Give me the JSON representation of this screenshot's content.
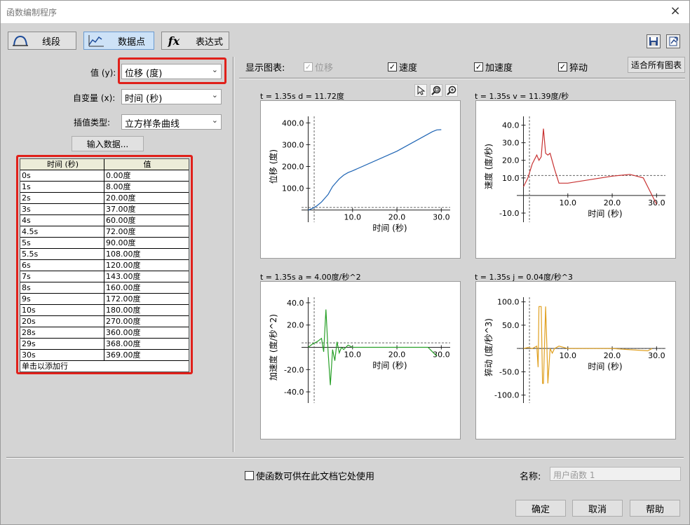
{
  "window": {
    "title": "函数编制程序",
    "close": "×"
  },
  "toolbar": {
    "tabs": [
      {
        "label": "线段",
        "icon": "line-segment-icon"
      },
      {
        "label": "数据点",
        "icon": "data-points-icon"
      },
      {
        "label": "表达式",
        "icon": "expression-icon"
      }
    ],
    "expression_glyph": "fx"
  },
  "left": {
    "value_label": "值 (y):",
    "value_selected": "位移 (度)",
    "indep_label": "自变量 (x):",
    "indep_selected": "时间 (秒)",
    "interp_label": "插值类型:",
    "interp_selected": "立方样条曲线",
    "input_button": "输入数据...",
    "table": {
      "headers": [
        "时间 (秒)",
        "值"
      ],
      "rows": [
        [
          "0s",
          "0.00度"
        ],
        [
          "1s",
          "8.00度"
        ],
        [
          "2s",
          "20.00度"
        ],
        [
          "3s",
          "37.00度"
        ],
        [
          "4s",
          "60.00度"
        ],
        [
          "4.5s",
          "72.00度"
        ],
        [
          "5s",
          "90.00度"
        ],
        [
          "5.5s",
          "108.00度"
        ],
        [
          "6s",
          "120.00度"
        ],
        [
          "7s",
          "143.00度"
        ],
        [
          "8s",
          "160.00度"
        ],
        [
          "9s",
          "172.00度"
        ],
        [
          "10s",
          "180.00度"
        ],
        [
          "20s",
          "270.00度"
        ],
        [
          "28s",
          "360.00度"
        ],
        [
          "29s",
          "368.00度"
        ],
        [
          "30s",
          "369.00度"
        ]
      ],
      "add_row": "单击以添加行"
    }
  },
  "right": {
    "show_label": "显示图表:",
    "checks": [
      {
        "label": "位移",
        "checked": true,
        "disabled": true
      },
      {
        "label": "速度",
        "checked": true,
        "disabled": false
      },
      {
        "label": "加速度",
        "checked": true,
        "disabled": false
      },
      {
        "label": "猝动",
        "checked": true,
        "disabled": false
      }
    ],
    "fit_button": "适合所有图表",
    "readouts": [
      "t = 1.35s  d = 11.72度",
      "t = 1.35s  v = 11.39度/秒",
      "t = 1.35s  a = 4.00度/秒^2",
      "t = 1.35s  j = 0.04度/秒^3"
    ]
  },
  "chart_data": [
    {
      "type": "line",
      "ylabel": "位移 (度)",
      "xlabel": "时间 (秒)",
      "xticks": [
        "10.0",
        "20.0",
        "30.0"
      ],
      "yticks": [
        "100.0",
        "200.0",
        "300.0",
        "400.0"
      ],
      "xlim": [
        -1.5,
        32
      ],
      "ylim": [
        -30,
        430
      ],
      "color": "#1e64b4",
      "cursor_x": 1.35,
      "cursor_y": 11.72,
      "x": [
        0,
        1,
        2,
        3,
        4,
        4.5,
        5,
        5.5,
        6,
        7,
        8,
        9,
        10,
        20,
        28,
        29,
        30
      ],
      "y": [
        0,
        8,
        20,
        37,
        60,
        72,
        90,
        108,
        120,
        143,
        160,
        172,
        180,
        270,
        360,
        368,
        369
      ]
    },
    {
      "type": "line",
      "ylabel": "速度 (度/秒)",
      "xlabel": "时间 (秒)",
      "xticks": [
        "10.0",
        "20.0",
        "30.0"
      ],
      "yticks": [
        "-10.0",
        "10.0",
        "20.0",
        "30.0",
        "40.0"
      ],
      "xlim": [
        -1.5,
        32
      ],
      "ylim": [
        -12,
        45
      ],
      "color": "#c83232",
      "cursor_x": 1.35,
      "cursor_y": 11.39,
      "x": [
        0,
        1,
        2,
        3,
        3.5,
        4,
        4.5,
        5,
        5.5,
        6,
        7,
        8,
        10,
        15,
        20,
        24,
        27,
        28,
        29,
        30
      ],
      "y": [
        5,
        10,
        18,
        23,
        20,
        22,
        38,
        24,
        23,
        24,
        15,
        7,
        7,
        9,
        11,
        12,
        10,
        5,
        0,
        -5
      ]
    },
    {
      "type": "line",
      "ylabel": "加速度 (度/秒^2)",
      "xlabel": "时间 (秒)",
      "xticks": [
        "10.0",
        "20.0",
        "30.0"
      ],
      "yticks": [
        "-40.0",
        "-20.0",
        "20.0",
        "40.0"
      ],
      "xlim": [
        -1.5,
        32
      ],
      "ylim": [
        -45,
        45
      ],
      "color": "#28a028",
      "cursor_x": 1.35,
      "cursor_y": 4.0,
      "x": [
        0,
        1,
        2,
        3,
        3.5,
        4,
        4.5,
        5,
        5.5,
        6,
        6.5,
        7,
        7.5,
        8,
        9,
        10,
        15,
        20,
        25,
        27,
        28,
        29
      ],
      "y": [
        0,
        3,
        5,
        8,
        -4,
        34,
        -5,
        -34,
        -2,
        -12,
        5,
        -5,
        0,
        -2,
        2,
        0,
        0,
        0,
        0,
        0,
        -4,
        -8
      ]
    },
    {
      "type": "line",
      "ylabel": "猝动 (度/秒^3)",
      "xlabel": "时间 (秒)",
      "xticks": [
        "10.0",
        "20.0",
        "30.0"
      ],
      "yticks": [
        "-100.0",
        "-50.0",
        "50.0",
        "100.0"
      ],
      "xlim": [
        -1.5,
        32
      ],
      "ylim": [
        -105,
        110
      ],
      "color": "#e0a020",
      "cursor_x": 1.35,
      "cursor_y": 0.04,
      "x": [
        0,
        1,
        2,
        3,
        3.3,
        3.5,
        4,
        4.3,
        4.5,
        5,
        5.3,
        5.5,
        6,
        6.5,
        7,
        8,
        10,
        20,
        28,
        29
      ],
      "y": [
        0,
        2,
        0,
        5,
        -40,
        90,
        90,
        -75,
        -75,
        90,
        0,
        -75,
        0,
        -10,
        0,
        5,
        0,
        0,
        -5,
        0
      ]
    }
  ],
  "footer": {
    "share_check": "使函数可供在此文档它处使用",
    "name_label": "名称:",
    "name_placeholder": "用户函数 1",
    "ok": "确定",
    "cancel": "取消",
    "help": "帮助"
  }
}
